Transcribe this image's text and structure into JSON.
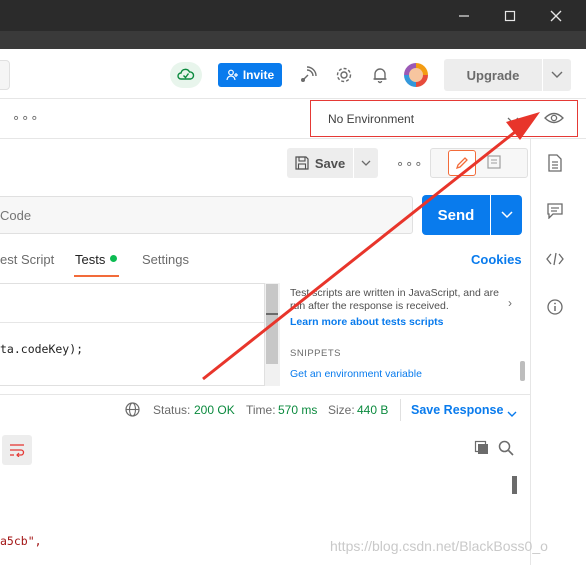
{
  "header": {
    "invite_label": "Invite",
    "upgrade_label": "Upgrade"
  },
  "environment": {
    "selected": "No Environment"
  },
  "request": {
    "save_label": "Save",
    "url_value": "Code",
    "send_label": "Send"
  },
  "tabs": [
    {
      "label": "est Script"
    },
    {
      "label": "Tests"
    },
    {
      "label": "Settings"
    }
  ],
  "cookies_label": "Cookies",
  "editor": {
    "code_line": "ta.codeKey);"
  },
  "help": {
    "text": "Test scripts are written in JavaScript, and are run after the response is received.",
    "link": "Learn more about tests scripts",
    "snippets_title": "SNIPPETS",
    "snippet_item": "Get an environment variable"
  },
  "response": {
    "status_label": "Status:",
    "status_value": "200 OK",
    "time_label": "Time:",
    "time_value": "570 ms",
    "size_label": "Size:",
    "size_value": "440 B",
    "save_response_label": "Save Response",
    "body_line": "a5cb\","
  },
  "watermark": "https://blog.csdn.net/BlackBoss0_o",
  "colors": {
    "accent_blue": "#097bed",
    "status_green": "#0b8a3e",
    "tab_orange": "#f26b3a",
    "annotation_red": "#e53935"
  }
}
